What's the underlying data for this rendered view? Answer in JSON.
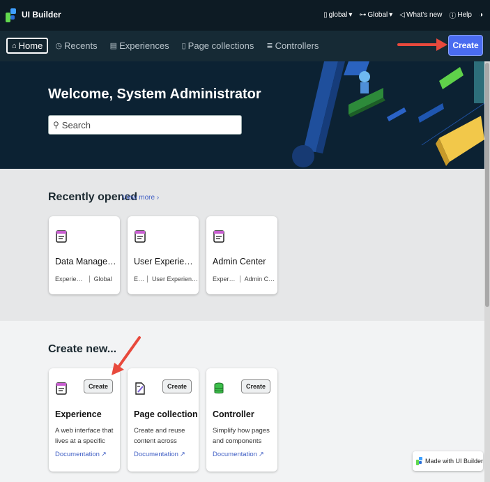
{
  "header": {
    "app_title": "UI Builder",
    "scope_label": "global",
    "domain_label": "Global",
    "whats_new": "What's new",
    "help": "Help"
  },
  "nav": {
    "tabs": [
      {
        "label": "Home",
        "icon": "home-icon"
      },
      {
        "label": "Recents",
        "icon": "history-icon"
      },
      {
        "label": "Experiences",
        "icon": "list-icon"
      },
      {
        "label": "Page collections",
        "icon": "page-icon"
      },
      {
        "label": "Controllers",
        "icon": "database-icon"
      }
    ],
    "create_label": "Create"
  },
  "hero": {
    "welcome": "Welcome, System Administrator",
    "search_placeholder": "Search"
  },
  "recent": {
    "title": "Recently opened",
    "view_more": "View more",
    "cards": [
      {
        "title": "Data Manageme...",
        "meta1": "Experience",
        "meta2": "Global"
      },
      {
        "title": "User Experience ...",
        "meta1": "E...",
        "meta2": "User Experienc..."
      },
      {
        "title": "Admin Center",
        "meta1": "Experi...",
        "meta2": "Admin Ce..."
      }
    ]
  },
  "create_new": {
    "title": "Create new...",
    "cards": [
      {
        "title": "Experience",
        "desc": "A web interface that lives at a specific URL",
        "button": "Create",
        "doc": "Documentation"
      },
      {
        "title": "Page collection",
        "desc": "Create and reuse content across",
        "button": "Create",
        "doc": "Documentation"
      },
      {
        "title": "Controller",
        "desc": "Simplify how pages and components",
        "button": "Create",
        "doc": "Documentation"
      }
    ]
  },
  "footer": {
    "made_with": "Made with UI Builder"
  },
  "colors": {
    "accent": "#4a6cf0",
    "arrow": "#e8493c",
    "topbar": "#0d1b24",
    "hero": "#0c2233"
  }
}
